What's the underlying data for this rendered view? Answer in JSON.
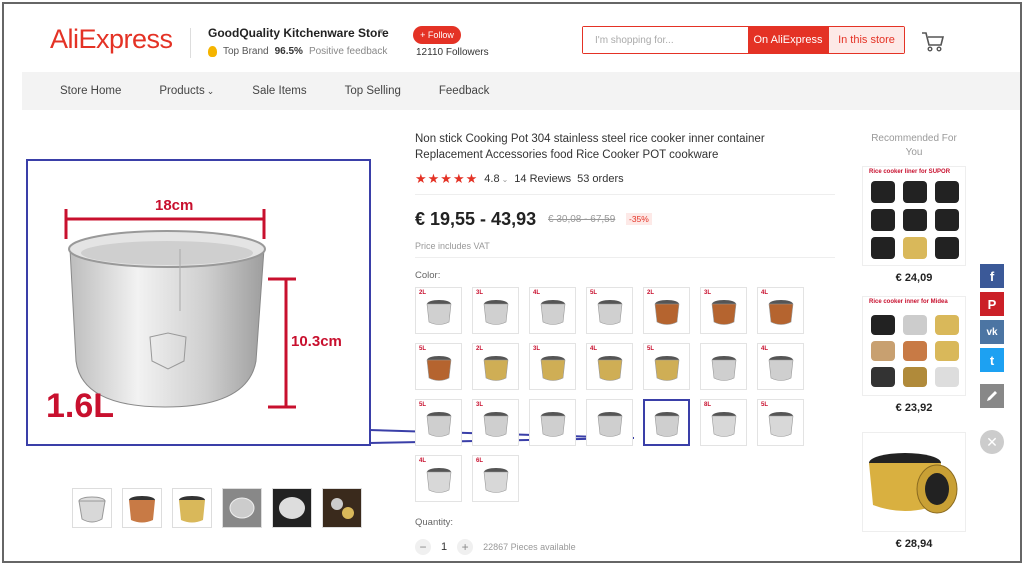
{
  "header": {
    "logo": "AliExpress",
    "store_name": "GoodQuality Kitchenware Store",
    "badge": "Top Brand",
    "feedback_percent": "96.5%",
    "feedback_label": "Positive feedback",
    "follow_label": "+ Follow",
    "followers": "12110 Followers",
    "search_placeholder": "I'm shopping for...",
    "search_btn_ali": "On AliExpress",
    "search_btn_store": "In this store"
  },
  "nav": {
    "items": [
      "Store Home",
      "Products",
      "Sale Items",
      "Top Selling",
      "Feedback"
    ]
  },
  "gallery": {
    "dim_width": "18cm",
    "dim_height": "10.3cm",
    "capacity": "1.6L"
  },
  "product": {
    "title": "Non stick Cooking Pot 304 stainless steel rice cooker inner container Replacement Accessories food Rice Cooker POT cookware",
    "rating": "4.8",
    "reviews": "14 Reviews",
    "orders": "53 orders",
    "price": "€ 19,55 - 43,93",
    "old_price": "€ 30,08 - 67,59",
    "discount": "-35%",
    "vat_note": "Price includes VAT",
    "color_label": "Color:",
    "quantity_label": "Quantity:",
    "quantity_value": "1",
    "pieces_available": "22867 Pieces available"
  },
  "swatches": {
    "row1": [
      "2L",
      "3L",
      "4L",
      "5L",
      "2L",
      "3L",
      "4L"
    ],
    "row2": [
      "5L",
      "2L",
      "3L",
      "4L",
      "5L",
      "",
      "4L"
    ],
    "row3": [
      "5L",
      "3L",
      "",
      "",
      "",
      "8L",
      "5L"
    ],
    "row4": [
      "4L",
      "6L"
    ]
  },
  "recommended": {
    "title": "Recommended For You",
    "items": [
      {
        "caption": "Rice cooker liner for SUPOR",
        "price": "€ 24,09"
      },
      {
        "caption": "Rice cooker inner for Midea",
        "price": "€ 23,92"
      },
      {
        "caption": "",
        "price": "€ 28,94"
      }
    ]
  },
  "social": {
    "facebook": "f",
    "pinterest": "P",
    "vk": "vk",
    "twitter": "t"
  },
  "colors": {
    "brand": "#e43225",
    "annotation": "#3a3fa8",
    "dimension": "#c8102e"
  }
}
